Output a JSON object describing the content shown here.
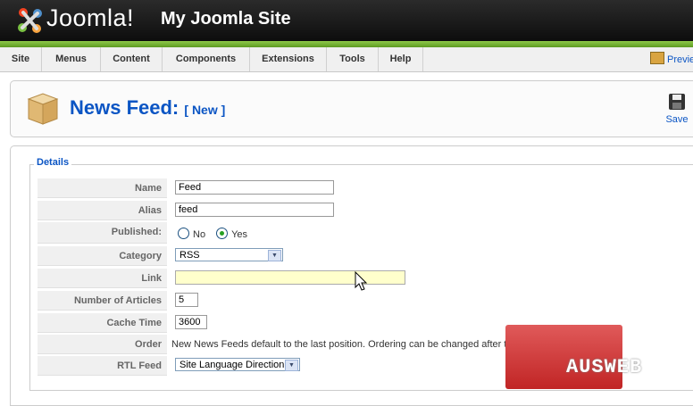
{
  "header": {
    "logo_text": "Joomla!",
    "site_name": "My Joomla Site"
  },
  "menu": {
    "items": [
      "Site",
      "Menus",
      "Content",
      "Components",
      "Extensions",
      "Tools",
      "Help"
    ],
    "preview_label": "Previe"
  },
  "toolbar": {
    "title": "News Feed:",
    "subtitle": "[ New ]",
    "save_label": "Save"
  },
  "form": {
    "legend": "Details",
    "name_label": "Name",
    "name_value": "Feed",
    "alias_label": "Alias",
    "alias_value": "feed",
    "published_label": "Published:",
    "published_no": "No",
    "published_yes": "Yes",
    "published_selected": "Yes",
    "category_label": "Category",
    "category_value": "RSS",
    "link_label": "Link",
    "link_value": "",
    "articles_label": "Number of Articles",
    "articles_value": "5",
    "cache_label": "Cache Time",
    "cache_value": "3600",
    "order_label": "Order",
    "order_text": "New News Feeds default to the last position. Ordering can be changed after this News Feed is saved.",
    "rtl_label": "RTL Feed",
    "rtl_value": "Site Language Direction"
  },
  "watermark": {
    "text": "AUSWEB"
  },
  "colors": {
    "title_blue": "#0b55c4",
    "header_green": "#7cb83a",
    "watermark_red": "#d03a3a",
    "link_highlight": "#ffffcc"
  }
}
